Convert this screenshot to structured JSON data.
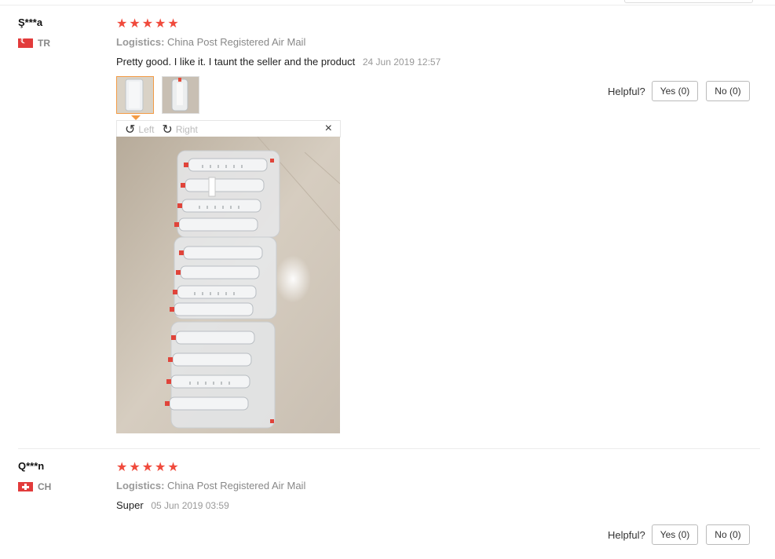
{
  "reviews": [
    {
      "user": "Ş***a",
      "country_code": "TR",
      "rating": 5,
      "logistics_label": "Logistics:",
      "logistics_value": "China Post Registered Air Mail",
      "text": "Pretty good. I like it. I taunt the seller and the product",
      "date": "24 Jun 2019 12:57",
      "helpful_label": "Helpful?",
      "yes_label": "Yes (0)",
      "no_label": "No (0)"
    },
    {
      "user": "Q***n",
      "country_code": "CH",
      "rating": 5,
      "logistics_label": "Logistics:",
      "logistics_value": "China Post Registered Air Mail",
      "text": "Super",
      "date": "05 Jun 2019 03:59",
      "helpful_label": "Helpful?",
      "yes_label": "Yes (0)",
      "no_label": "No (0)"
    }
  ],
  "viewer": {
    "rotate_left_label": "Left",
    "rotate_right_label": "Right",
    "close_icon": "close-icon"
  },
  "colors": {
    "star": "#f04a3c",
    "active_thumb_border": "#f39b45"
  }
}
